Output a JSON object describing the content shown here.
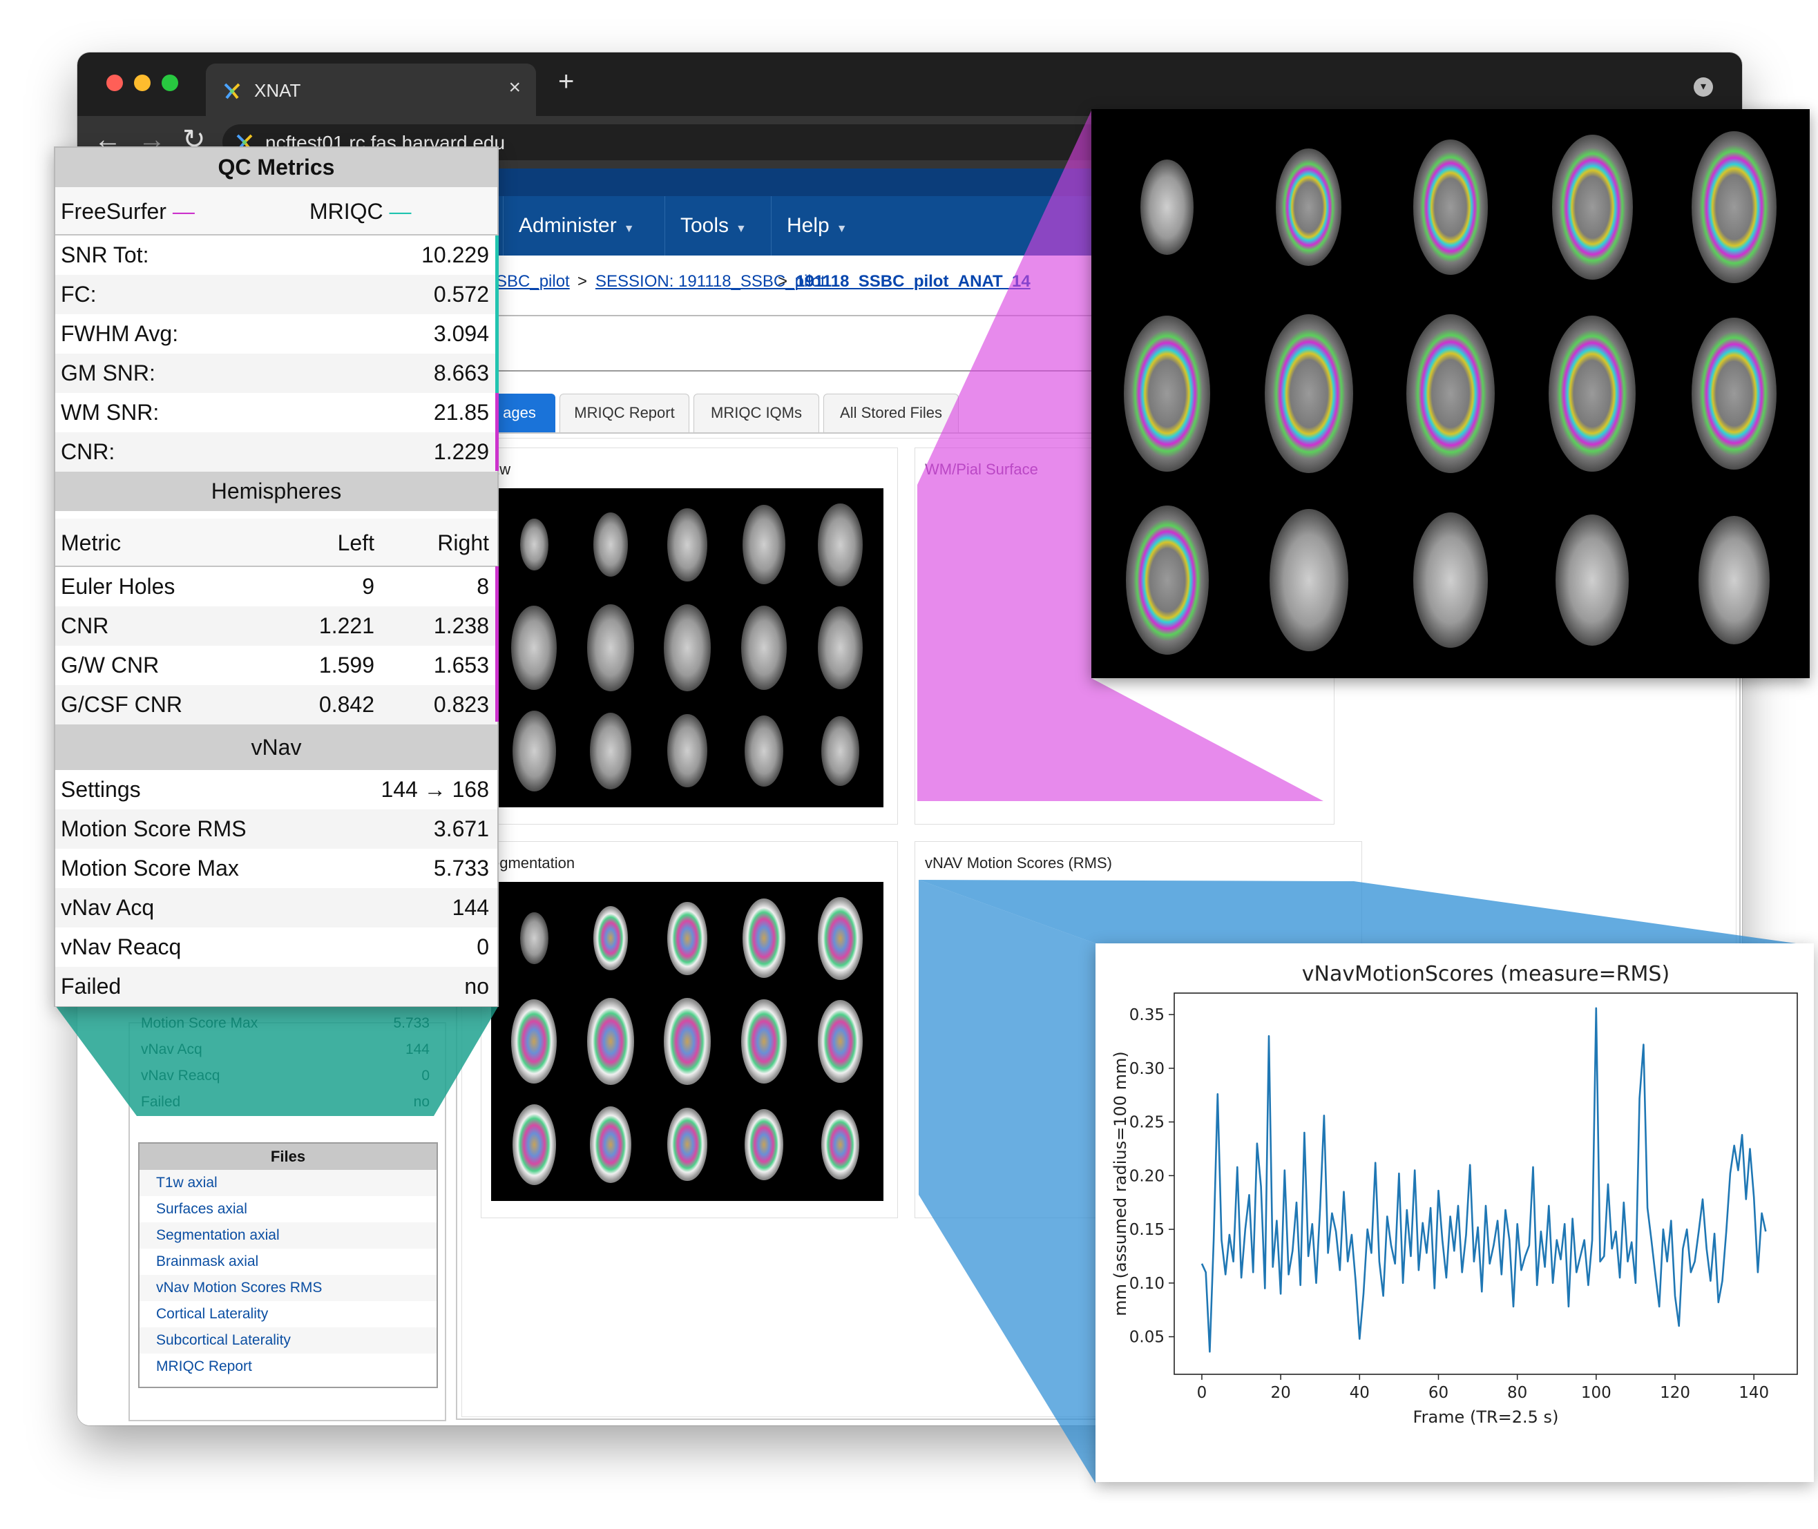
{
  "browser": {
    "tab_title": "XNAT",
    "tab_close": "×",
    "new_tab": "+",
    "url": "ncftest01.rc.fas.harvard.edu",
    "nav": {
      "back": "←",
      "forward": "→",
      "reload": "↻"
    }
  },
  "navbar": {
    "items": [
      {
        "label": "Administer"
      },
      {
        "label": "Tools"
      },
      {
        "label": "Help"
      }
    ],
    "caret": "▼"
  },
  "breadcrumb": {
    "project": "SBC_pilot",
    "sep": ">",
    "session": "SESSION: 191118_SSBC_pilot",
    "scan": "191118_SSBC_pilot_ANAT_14"
  },
  "tabs": [
    {
      "label": "ages"
    },
    {
      "label": "MRIQC Report"
    },
    {
      "label": "MRIQC IQMs"
    },
    {
      "label": "All Stored Files"
    }
  ],
  "panels": {
    "t1w": "1w",
    "pial": "WM/Pial Surface",
    "segmentation": "egmentation",
    "vnav": "vNAV Motion Scores (RMS)"
  },
  "ghost_rows": [
    {
      "label": "Motion Score Max",
      "value": "5.733"
    },
    {
      "label": "vNav Acq",
      "value": "144"
    },
    {
      "label": "vNav Reacq",
      "value": "0"
    },
    {
      "label": "Failed",
      "value": "no"
    }
  ],
  "files": {
    "title": "Files",
    "items": [
      "T1w axial",
      "Surfaces axial",
      "Segmentation axial",
      "Brainmask axial",
      "vNav Motion Scores RMS",
      "Cortical Laterality",
      "Subcortical Laterality",
      "MRIQC Report"
    ]
  },
  "qc": {
    "title": "QC Metrics",
    "legend": {
      "freesurfer": "FreeSurfer",
      "mriqc": "MRIQC",
      "dash": "—"
    },
    "colors": {
      "freesurfer": "#cc33cc",
      "mriqc": "#21c4b0",
      "vnav": "#1f77b4"
    },
    "metrics": [
      {
        "label": "SNR Tot:",
        "value": "10.229"
      },
      {
        "label": "FC:",
        "value": "0.572"
      },
      {
        "label": "FWHM Avg:",
        "value": "3.094"
      },
      {
        "label": "GM SNR:",
        "value": "8.663"
      },
      {
        "label": "WM SNR:",
        "value": "21.85"
      },
      {
        "label": "CNR:",
        "value": "1.229"
      }
    ],
    "hemispheres": {
      "title": "Hemispheres",
      "header": {
        "metric": "Metric",
        "left": "Left",
        "right": "Right"
      },
      "rows": [
        {
          "label": "Euler Holes",
          "left": "9",
          "right": "8"
        },
        {
          "label": "CNR",
          "left": "1.221",
          "right": "1.238"
        },
        {
          "label": "G/W CNR",
          "left": "1.599",
          "right": "1.653"
        },
        {
          "label": "G/CSF CNR",
          "left": "0.842",
          "right": "0.823"
        }
      ]
    },
    "vnav": {
      "title": "vNav",
      "rows": [
        {
          "label": "Settings",
          "value": "144 → 168"
        },
        {
          "label": "Motion Score RMS",
          "value": "3.671"
        },
        {
          "label": "Motion Score Max",
          "value": "5.733"
        },
        {
          "label": "vNav Acq",
          "value": "144"
        },
        {
          "label": "vNav Reacq",
          "value": "0"
        },
        {
          "label": "Failed",
          "value": "no"
        }
      ]
    }
  },
  "chart_data": {
    "type": "line",
    "title": "vNavMotionScores (measure=RMS)",
    "xlabel": "Frame (TR=2.5 s)",
    "ylabel": "mm (assumed radius=100 mm)",
    "xlim": [
      -7,
      151
    ],
    "ylim": [
      0.015,
      0.37
    ],
    "xticks": [
      0,
      20,
      40,
      60,
      80,
      100,
      120,
      140
    ],
    "yticks": [
      0.05,
      0.1,
      0.15,
      0.2,
      0.25,
      0.3,
      0.35
    ],
    "grid": false,
    "color": "#1f77b4",
    "series": [
      {
        "x": [
          0,
          1,
          2,
          3,
          4,
          5,
          6,
          7,
          8,
          9,
          10,
          11,
          12,
          13,
          14,
          15,
          16,
          17,
          18,
          19,
          20,
          21,
          22,
          23,
          24,
          25,
          26,
          27,
          28,
          29,
          30,
          31,
          32,
          33,
          34,
          35,
          36,
          37,
          38,
          39,
          40,
          41,
          42,
          43,
          44,
          45,
          46,
          47,
          48,
          49,
          50,
          51,
          52,
          53,
          54,
          55,
          56,
          57,
          58,
          59,
          60,
          61,
          62,
          63,
          64,
          65,
          66,
          67,
          68,
          69,
          70,
          71,
          72,
          73,
          74,
          75,
          76,
          77,
          78,
          79,
          80,
          81,
          82,
          83,
          84,
          85,
          86,
          87,
          88,
          89,
          90,
          91,
          92,
          93,
          94,
          95,
          96,
          97,
          98,
          99,
          100,
          101,
          102,
          103,
          104,
          105,
          106,
          107,
          108,
          109,
          110,
          111,
          112,
          113,
          114,
          115,
          116,
          117,
          118,
          119,
          120,
          121,
          122,
          123,
          124,
          125,
          126,
          127,
          128,
          129,
          130,
          131,
          132,
          133,
          134,
          135,
          136,
          137,
          138,
          139,
          140,
          141,
          142,
          143
        ],
        "y": [
          0.118,
          0.11,
          0.036,
          0.14,
          0.276,
          0.14,
          0.108,
          0.145,
          0.12,
          0.208,
          0.105,
          0.15,
          0.182,
          0.11,
          0.23,
          0.19,
          0.095,
          0.33,
          0.115,
          0.158,
          0.09,
          0.205,
          0.108,
          0.13,
          0.175,
          0.098,
          0.24,
          0.125,
          0.155,
          0.1,
          0.17,
          0.256,
          0.128,
          0.165,
          0.148,
          0.112,
          0.185,
          0.12,
          0.145,
          0.102,
          0.048,
          0.09,
          0.15,
          0.128,
          0.212,
          0.12,
          0.088,
          0.162,
          0.135,
          0.118,
          0.202,
          0.1,
          0.168,
          0.125,
          0.205,
          0.112,
          0.156,
          0.128,
          0.17,
          0.095,
          0.186,
          0.14,
          0.105,
          0.162,
          0.13,
          0.172,
          0.11,
          0.145,
          0.21,
          0.12,
          0.152,
          0.092,
          0.172,
          0.118,
          0.135,
          0.158,
          0.108,
          0.168,
          0.14,
          0.078,
          0.155,
          0.112,
          0.125,
          0.135,
          0.208,
          0.098,
          0.148,
          0.115,
          0.172,
          0.1,
          0.14,
          0.122,
          0.155,
          0.078,
          0.16,
          0.11,
          0.125,
          0.14,
          0.098,
          0.14,
          0.356,
          0.12,
          0.125,
          0.192,
          0.132,
          0.148,
          0.105,
          0.175,
          0.12,
          0.138,
          0.1,
          0.272,
          0.322,
          0.17,
          0.14,
          0.108,
          0.078,
          0.15,
          0.12,
          0.158,
          0.088,
          0.06,
          0.132,
          0.15,
          0.11,
          0.12,
          0.148,
          0.178,
          0.132,
          0.102,
          0.146,
          0.082,
          0.102,
          0.148,
          0.202,
          0.228,
          0.205,
          0.238,
          0.178,
          0.225,
          0.18,
          0.11,
          0.165,
          0.148
        ]
      }
    ]
  }
}
